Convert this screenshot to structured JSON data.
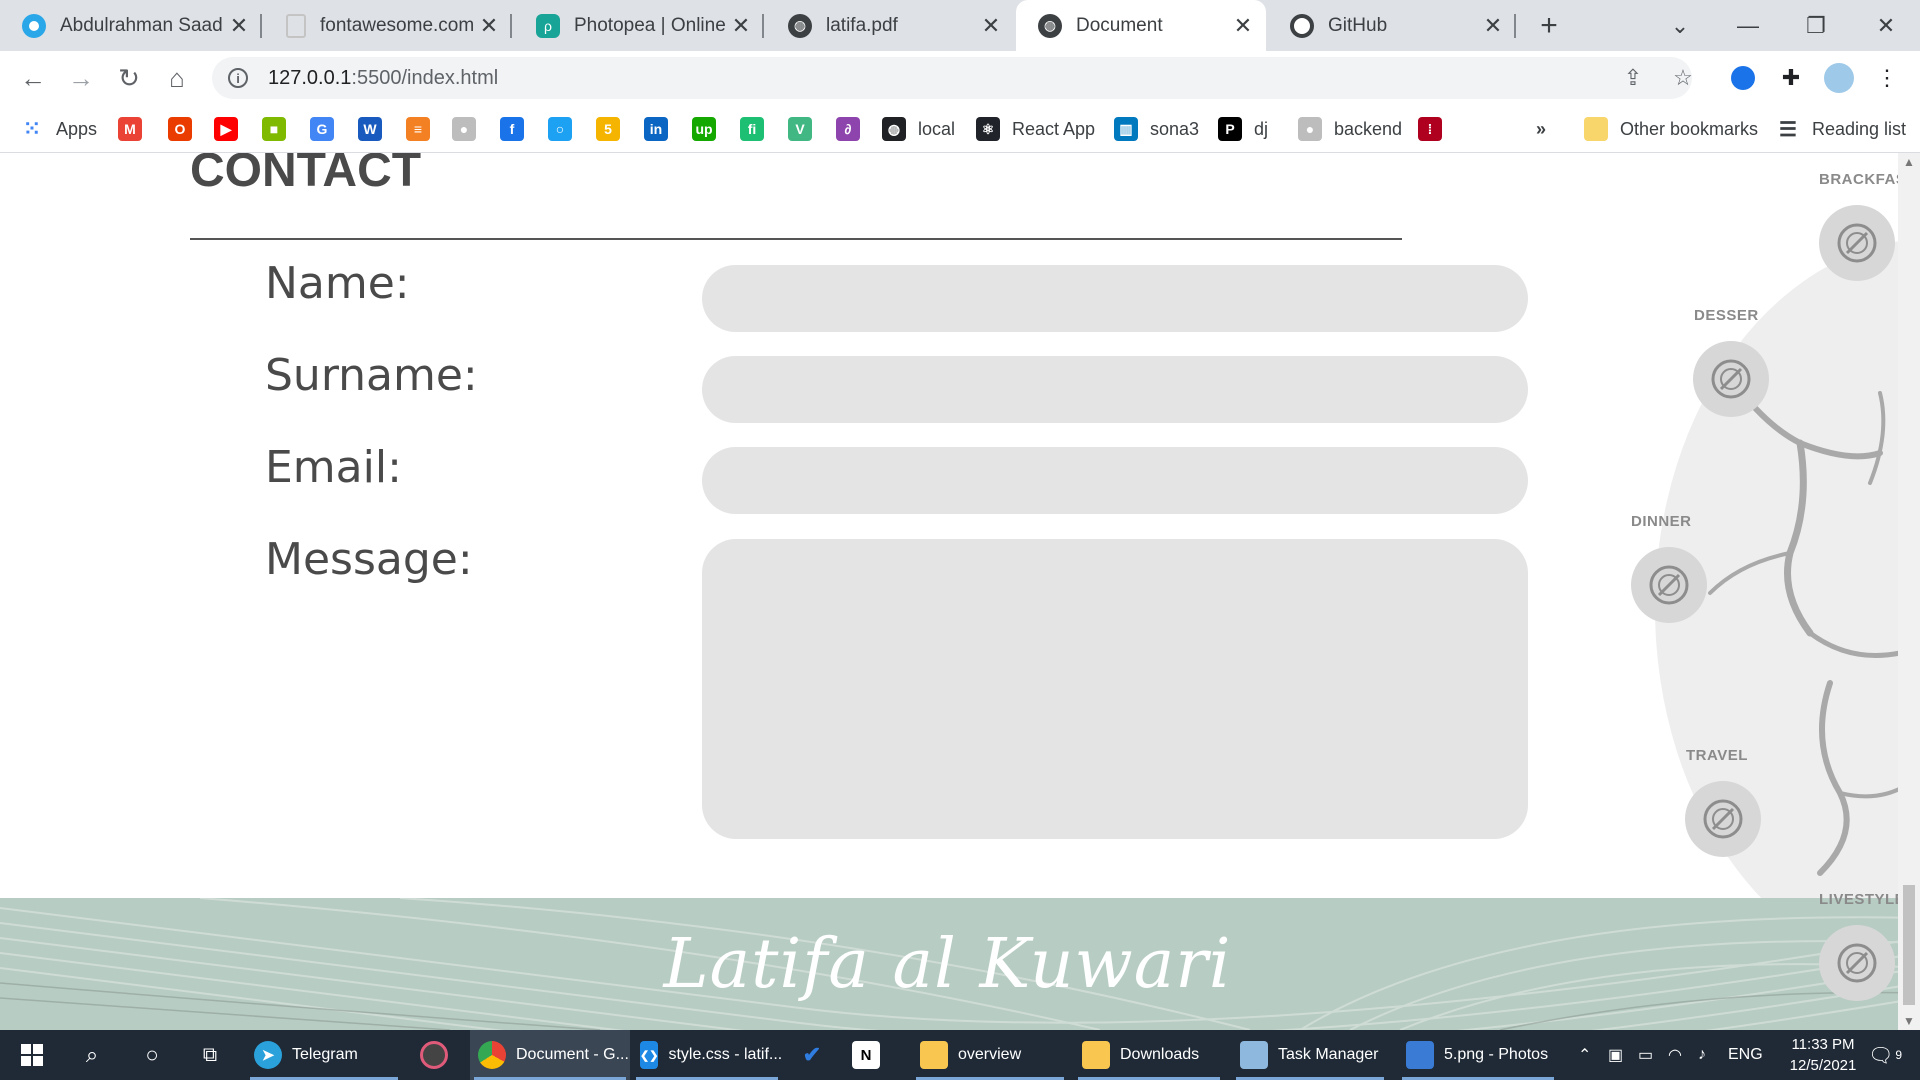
{
  "browser": {
    "tabs": [
      {
        "label": "Abdulrahman Saad |",
        "icon": "circle-blue-icon",
        "color": "#2aa7e8"
      },
      {
        "label": "fontawesome.com",
        "icon": "page-icon",
        "color": "#cfcfcf"
      },
      {
        "label": "Photopea | Online Ph",
        "icon": "photopea-icon",
        "color": "#18a497"
      },
      {
        "label": "latifa.pdf",
        "icon": "globe-icon",
        "color": "#3c4043"
      },
      {
        "label": "Document",
        "icon": "globe-icon",
        "color": "#3c4043",
        "active": true
      },
      {
        "label": "GitHub",
        "icon": "github-icon",
        "color": "#ffffff"
      }
    ],
    "new_tab": "+",
    "window_controls": {
      "minimize": "—",
      "restore": "❐",
      "close": "✕",
      "tab_search": "⌄"
    },
    "toolbar": {
      "back": "←",
      "forward": "→",
      "reload": "↻",
      "home": "⌂",
      "url_host": "127.0.0.1",
      "url_path": ":5500/index.html",
      "info": "i"
    },
    "bookmarks": [
      {
        "label": "Apps",
        "icon": "apps-grid-icon",
        "color": "#4285f4"
      },
      {
        "label": "",
        "icon": "gmail-icon",
        "color": "#ea4335",
        "glyph": "M"
      },
      {
        "label": "",
        "icon": "office-icon",
        "color": "#eb3c00",
        "glyph": "O"
      },
      {
        "label": "",
        "icon": "youtube-icon",
        "color": "#ff0000",
        "glyph": "▶"
      },
      {
        "label": "",
        "icon": "microsoft-icon",
        "color": "#7fba00",
        "glyph": "■"
      },
      {
        "label": "",
        "icon": "translate-icon",
        "color": "#4285f4",
        "glyph": "G"
      },
      {
        "label": "",
        "icon": "word-icon",
        "color": "#185abd",
        "glyph": "W"
      },
      {
        "label": "",
        "icon": "stackoverflow-icon",
        "color": "#f48024",
        "glyph": "≡"
      },
      {
        "label": "",
        "icon": "github-icon",
        "color": "#bdbdbd",
        "glyph": "●"
      },
      {
        "label": "",
        "icon": "freecodecamp-icon",
        "color": "#1a73e8",
        "glyph": "f"
      },
      {
        "label": "",
        "icon": "circle-icon",
        "color": "#1da1f2",
        "glyph": "○"
      },
      {
        "label": "",
        "icon": "html5-icon",
        "color": "#f4b400",
        "glyph": "5"
      },
      {
        "label": "",
        "icon": "linkedin-icon",
        "color": "#0a66c2",
        "glyph": "in"
      },
      {
        "label": "",
        "icon": "upwork-icon",
        "color": "#14a800",
        "glyph": "up"
      },
      {
        "label": "",
        "icon": "fiverr-icon",
        "color": "#1dbf73",
        "glyph": "fi"
      },
      {
        "label": "",
        "icon": "vue-icon",
        "color": "#41b883",
        "glyph": "V"
      },
      {
        "label": "",
        "icon": "swirl-icon",
        "color": "#8e44ad",
        "glyph": "∂"
      },
      {
        "label": "local",
        "icon": "globe-icon",
        "color": "#202124",
        "glyph": "◍"
      },
      {
        "label": "React App",
        "icon": "react-icon",
        "color": "#20232a",
        "glyph": "⚛"
      },
      {
        "label": "sona3",
        "icon": "trello-icon",
        "color": "#0079bf",
        "glyph": "▥"
      },
      {
        "label": "dj",
        "icon": "p-icon",
        "color": "#000000",
        "glyph": "P"
      },
      {
        "label": "backend",
        "icon": "github-icon",
        "color": "#bdbdbd",
        "glyph": "●"
      },
      {
        "label": "",
        "icon": "red-dots-icon",
        "color": "#b00020",
        "glyph": "⁞"
      }
    ],
    "overflow": "»",
    "other_bookmarks": "Other bookmarks",
    "reading_list": "Reading list"
  },
  "page": {
    "title": "CONTACT",
    "fields": [
      {
        "label": "Name:"
      },
      {
        "label": "Surname:"
      },
      {
        "label": "Email:"
      },
      {
        "label": "Message:"
      }
    ],
    "categories": [
      {
        "label": "BRACKFAS",
        "icon": "plate-icon"
      },
      {
        "label": "DESSER",
        "icon": "plate-icon"
      },
      {
        "label": "DINNER",
        "icon": "plate-icon"
      },
      {
        "label": "TRAVEL",
        "icon": "plate-icon"
      },
      {
        "label": "LIVESTYLE",
        "icon": "plate-icon"
      }
    ],
    "footer_brand": "Latifa al Kuwari",
    "colors": {
      "footer": "#b7ccc3",
      "input": "#e4e4e4",
      "title": "#4a4a4a"
    }
  },
  "taskbar": {
    "items": [
      {
        "label": "Telegram",
        "icon": "telegram-icon",
        "color": "#2aa1da"
      },
      {
        "label": "",
        "icon": "media-icon",
        "color": "#e05a7a"
      },
      {
        "label": "Document - G...",
        "icon": "chrome-icon",
        "color": "#fbbc05",
        "open": true
      },
      {
        "label": "style.css - latif...",
        "icon": "vscode-icon",
        "color": "#1e88e5"
      },
      {
        "label": "",
        "icon": "todo-icon",
        "color": "#2f7de1"
      },
      {
        "label": "",
        "icon": "notion-icon",
        "color": "#ffffff"
      },
      {
        "label": "overview",
        "icon": "folder-icon",
        "color": "#f9c74f"
      },
      {
        "label": "Downloads",
        "icon": "folder-icon",
        "color": "#f9c74f"
      },
      {
        "label": "Task Manager",
        "icon": "task-manager-icon",
        "color": "#8fb8de"
      },
      {
        "label": "5.png - Photos",
        "icon": "photos-icon",
        "color": "#3a7bd5"
      }
    ],
    "language": "ENG",
    "time": "11:33 PM",
    "date": "12/5/2021",
    "notifications": "9"
  }
}
